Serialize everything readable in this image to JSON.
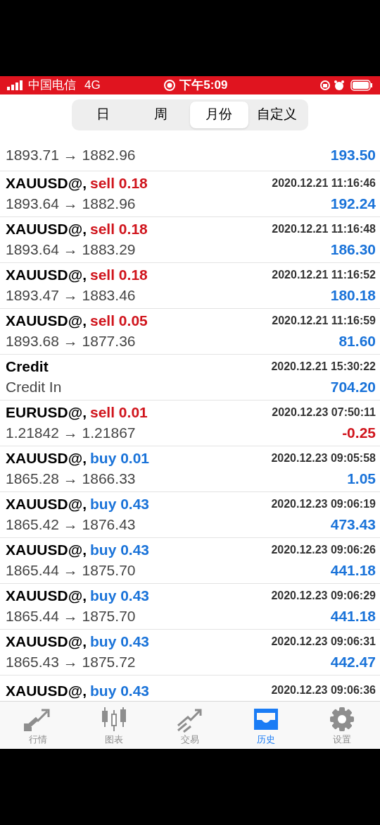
{
  "status_bar": {
    "carrier": "中国电信",
    "network": "4G",
    "time": "下午5:09"
  },
  "segments": [
    {
      "label": "日",
      "selected": false
    },
    {
      "label": "周",
      "selected": false
    },
    {
      "label": "月份",
      "selected": true
    },
    {
      "label": "自定义",
      "selected": false
    }
  ],
  "partial_row": {
    "prices": "1893.71 → 1882.96",
    "profit": "193.50",
    "loss": false
  },
  "deals": [
    {
      "symbol": "XAUUSD@,",
      "kind": "sell",
      "action": "sell 0.18",
      "time": "2020.12.21 11:16:46",
      "prices": "1893.64 → 1882.96",
      "profit": "192.24",
      "loss": false
    },
    {
      "symbol": "XAUUSD@,",
      "kind": "sell",
      "action": "sell 0.18",
      "time": "2020.12.21 11:16:48",
      "prices": "1893.64 → 1883.29",
      "profit": "186.30",
      "loss": false
    },
    {
      "symbol": "XAUUSD@,",
      "kind": "sell",
      "action": "sell 0.18",
      "time": "2020.12.21 11:16:52",
      "prices": "1893.47 → 1883.46",
      "profit": "180.18",
      "loss": false
    },
    {
      "symbol": "XAUUSD@,",
      "kind": "sell",
      "action": "sell 0.05",
      "time": "2020.12.21 11:16:59",
      "prices": "1893.68 → 1877.36",
      "profit": "81.60",
      "loss": false
    },
    {
      "symbol": "Credit",
      "kind": "balance",
      "time": "2020.12.21 15:30:22",
      "prices": "Credit In",
      "profit": "704.20",
      "loss": false
    },
    {
      "symbol": "EURUSD@,",
      "kind": "sell",
      "action": "sell 0.01",
      "time": "2020.12.23 07:50:11",
      "prices": "1.21842 → 1.21867",
      "profit": "-0.25",
      "loss": true
    },
    {
      "symbol": "XAUUSD@,",
      "kind": "buy",
      "action": "buy 0.01",
      "time": "2020.12.23 09:05:58",
      "prices": "1865.28 → 1866.33",
      "profit": "1.05",
      "loss": false
    },
    {
      "symbol": "XAUUSD@,",
      "kind": "buy",
      "action": "buy 0.43",
      "time": "2020.12.23 09:06:19",
      "prices": "1865.42 → 1876.43",
      "profit": "473.43",
      "loss": false
    },
    {
      "symbol": "XAUUSD@,",
      "kind": "buy",
      "action": "buy 0.43",
      "time": "2020.12.23 09:06:26",
      "prices": "1865.44 → 1875.70",
      "profit": "441.18",
      "loss": false
    },
    {
      "symbol": "XAUUSD@,",
      "kind": "buy",
      "action": "buy 0.43",
      "time": "2020.12.23 09:06:29",
      "prices": "1865.44 → 1875.70",
      "profit": "441.18",
      "loss": false
    },
    {
      "symbol": "XAUUSD@,",
      "kind": "buy",
      "action": "buy 0.43",
      "time": "2020.12.23 09:06:31",
      "prices": "1865.43 → 1875.72",
      "profit": "442.47",
      "loss": false
    }
  ],
  "partial_deal": {
    "symbol": "XAUUSD@,",
    "kind": "buy",
    "action": "buy 0.43",
    "time": "2020.12.23 09:06:36"
  },
  "tab_bar": [
    {
      "label": "行情",
      "kind": "quotes",
      "selected": false
    },
    {
      "label": "图表",
      "kind": "chart",
      "selected": false
    },
    {
      "label": "交易",
      "kind": "trade",
      "selected": false
    },
    {
      "label": "历史",
      "kind": "history",
      "selected": true
    },
    {
      "label": "设置",
      "kind": "settings",
      "selected": false
    }
  ]
}
